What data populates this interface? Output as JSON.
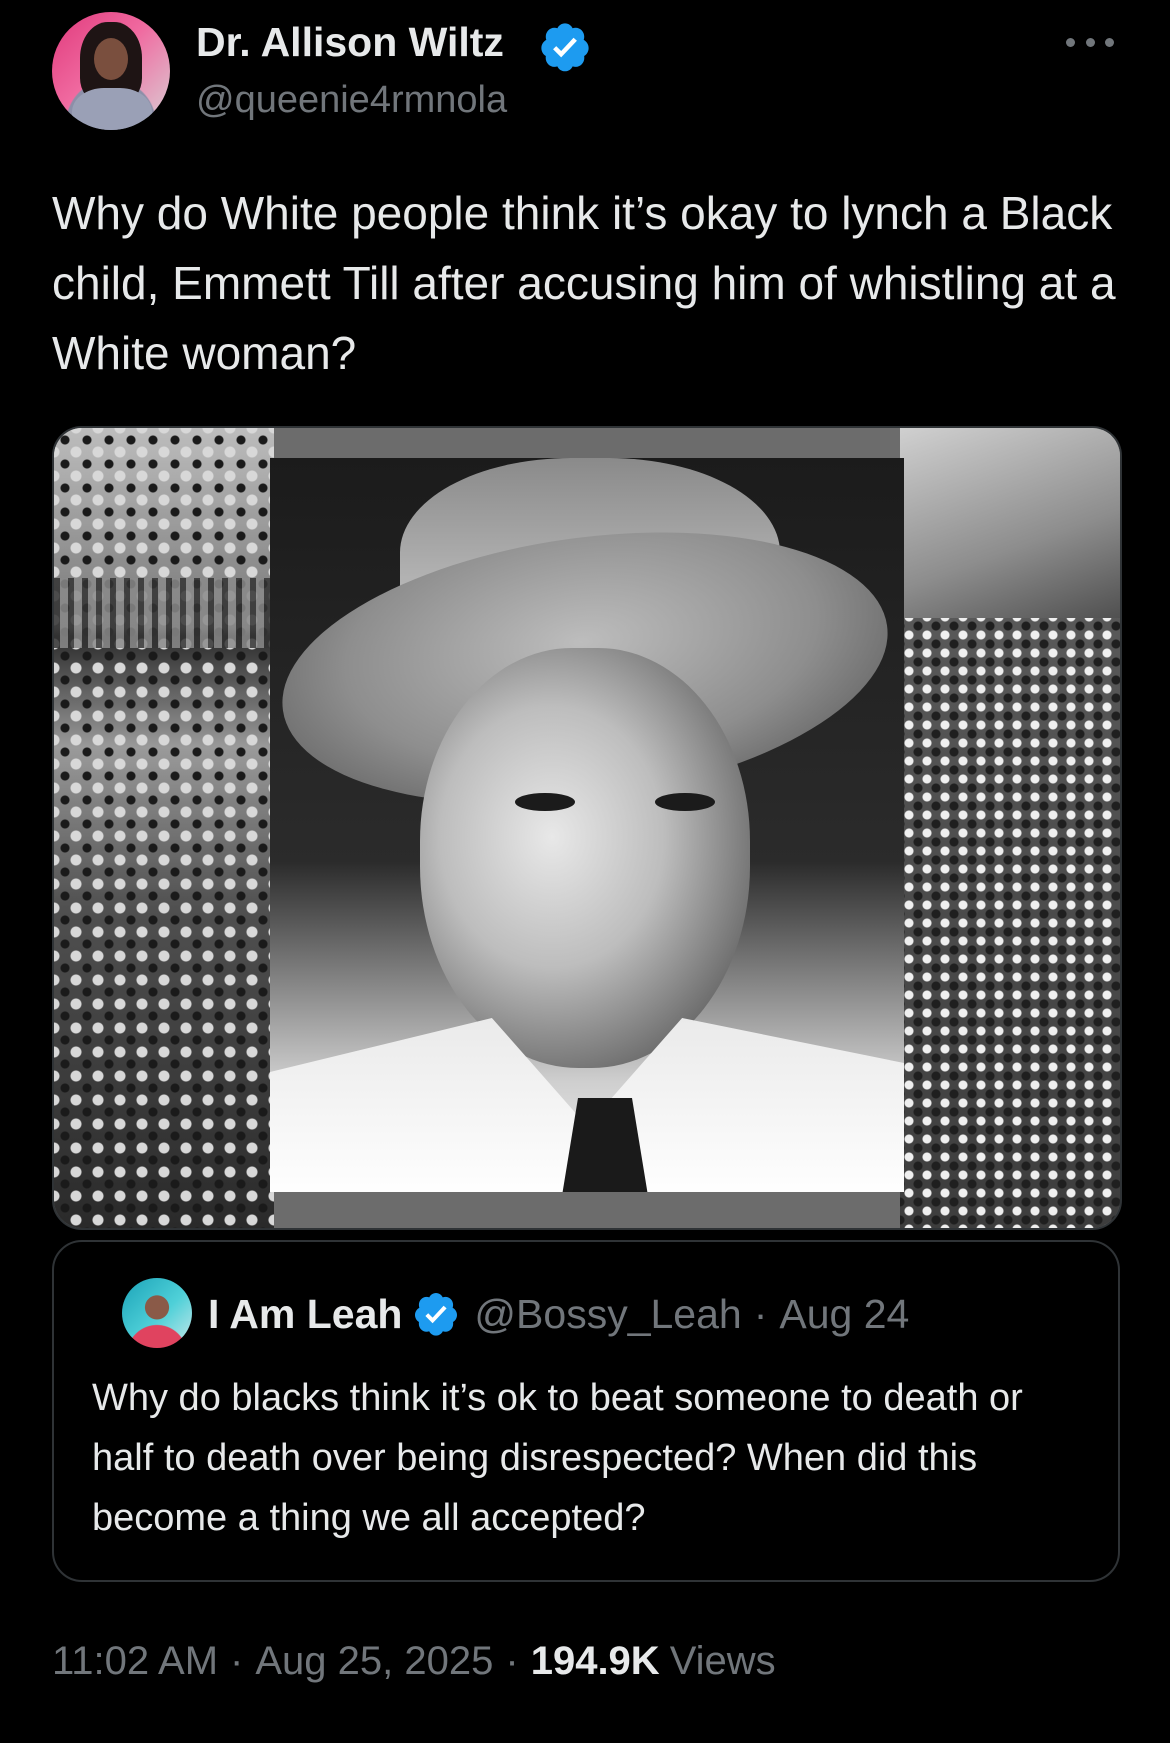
{
  "tweet": {
    "author": {
      "name": "Dr. Allison Wiltz",
      "handle": "@queenie4rmnola",
      "verified": true
    },
    "text": "Why do White people think it’s okay to lynch a Black child, Emmett Till after accusing him of whistling at a White woman?",
    "timestamp_time": "11:02 AM",
    "separator": "·",
    "timestamp_date": "Aug 25, 2025",
    "views_count": "194.9K",
    "views_label": "Views"
  },
  "quote": {
    "author": {
      "name": "I Am Leah",
      "handle": "@Bossy_Leah",
      "verified": true
    },
    "separator": "·",
    "date": "Aug 24",
    "text": "Why do blacks think it’s ok to beat someone to death or half to death over being disrespected? When did this become a thing we all accepted?"
  },
  "icons": {
    "more": "more-horizontal-icon",
    "verified": "verified-badge-icon"
  },
  "colors": {
    "background": "#000000",
    "primary_text": "#e7e9ea",
    "secondary_text": "#71767b",
    "border": "#2f3336",
    "verified": "#1d9bf0"
  }
}
